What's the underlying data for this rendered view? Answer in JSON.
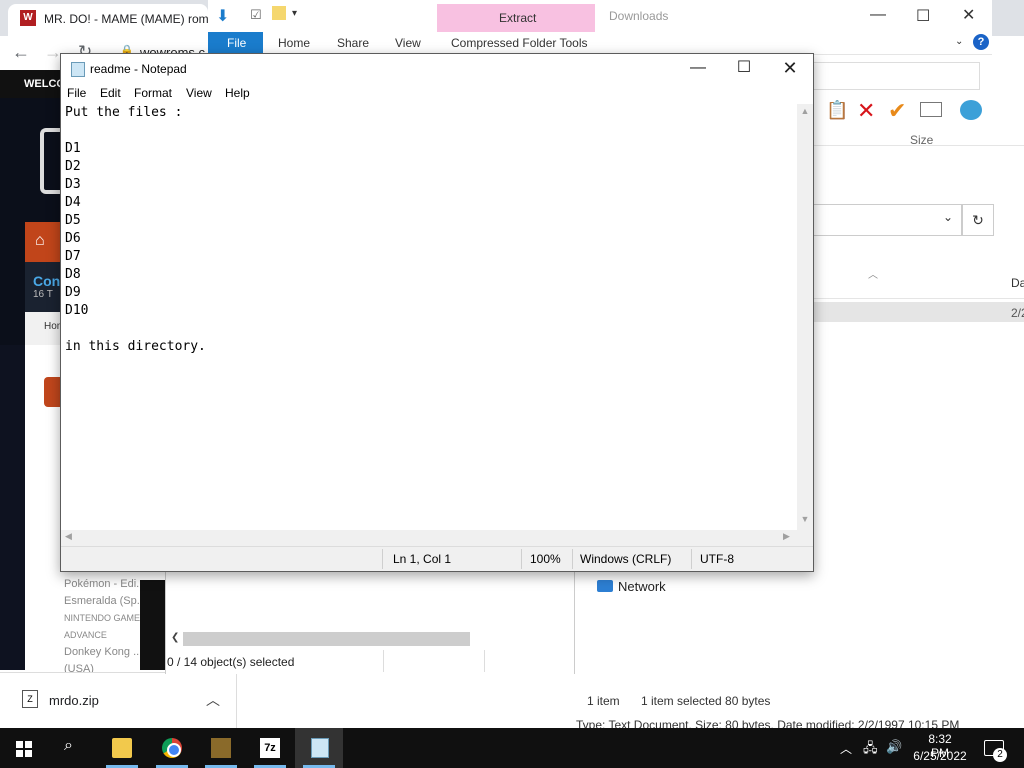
{
  "browser": {
    "tab_title": "MR. DO! - MAME (MAME) rom",
    "favicon_letter": "W",
    "url_fragment": "wowroms.c",
    "site": {
      "banner": "WELCO",
      "home": "Hom",
      "console_title": "Con",
      "console_sub": "16 T",
      "side_items": [
        "Pokémon - Edi...",
        "Esmeralda (Sp...",
        "NINTENDO GAME...",
        "ADVANCE",
        "Donkey Kong ...",
        "(USA)"
      ]
    },
    "download": {
      "filename": "mrdo.zip"
    }
  },
  "explorer": {
    "window_title": "Downloads",
    "contextual_tab": "Extract",
    "tabs": [
      "File",
      "Home",
      "Share",
      "View",
      "Compressed Folder Tools"
    ],
    "size_header": "Size",
    "date_header": "Da",
    "row_date": "2/2",
    "network_label": "Network",
    "status_items": "1 item",
    "status_selected": "1 item selected  80 bytes",
    "status_type": "Type: Text Document, Size: 80 bytes, Date modified: 2/2/1997 10:15 PM",
    "secondary_status": "0 / 14 object(s) selected"
  },
  "notepad": {
    "title": "readme - Notepad",
    "menu": [
      "File",
      "Edit",
      "Format",
      "View",
      "Help"
    ],
    "content": "Put the files :\n\nD1\nD2\nD3\nD4\nD5\nD6\nD7\nD8\nD9\nD10\n\nin this directory.",
    "status": {
      "position": "Ln 1, Col 1",
      "zoom": "100%",
      "line_ending": "Windows (CRLF)",
      "encoding": "UTF-8"
    }
  },
  "taskbar": {
    "time": "8:32 PM",
    "date": "6/25/2022",
    "notification_count": "2",
    "apps": [
      "file-explorer",
      "chrome",
      "dosbox",
      "7zip",
      "notepad"
    ]
  },
  "colors": {
    "accent_blue": "#1a7ccc",
    "extract_pink": "#f8c1e1",
    "taskbar": "#101010"
  }
}
